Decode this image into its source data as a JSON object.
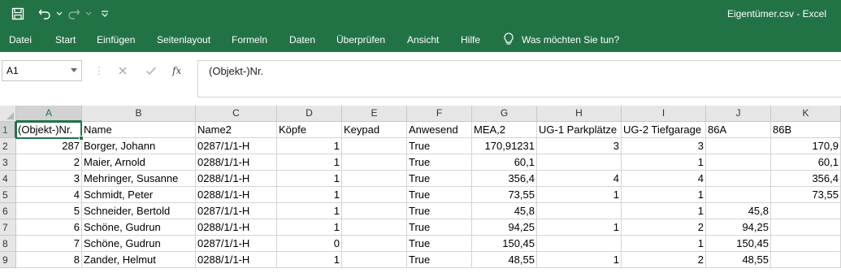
{
  "window": {
    "title": "Eigentümer.csv  -  Excel"
  },
  "qat": {
    "icons": [
      "save-icon",
      "undo-icon",
      "redo-icon",
      "customize-icon"
    ]
  },
  "ribbon": {
    "tabs": [
      "Datei",
      "Start",
      "Einfügen",
      "Seitenlayout",
      "Formeln",
      "Daten",
      "Überprüfen",
      "Ansicht",
      "Hilfe"
    ],
    "tell_me": "Was möchten Sie tun?"
  },
  "formula_bar": {
    "name_box": "A1",
    "fx_label": "fx",
    "value": "(Objekt-)Nr."
  },
  "colors": {
    "accent": "#217346",
    "header_bg": "#e6e6e6",
    "gridline": "#d4d4d4"
  },
  "sheet": {
    "columns": [
      "A",
      "B",
      "C",
      "D",
      "E",
      "F",
      "G",
      "H",
      "I",
      "J",
      "K"
    ],
    "row_numbers": [
      "1",
      "2",
      "3",
      "4",
      "5",
      "6",
      "7",
      "8",
      "9"
    ],
    "rows": [
      [
        "(Objekt-)Nr.",
        "Name",
        "Name2",
        "Köpfe",
        "Keypad",
        "Anwesend",
        "MEA,2",
        "UG-1 Parkplätze",
        "UG-2 Tiefgarage",
        "86A",
        "86B"
      ],
      [
        "287",
        "Borger, Johann",
        "0287/1/1-H",
        "1",
        "",
        "True",
        "170,91231",
        "3",
        "3",
        "",
        "170,9"
      ],
      [
        "2",
        "Maier, Arnold",
        "0288/1/1-H",
        "1",
        "",
        "True",
        "60,1",
        "",
        "1",
        "",
        "60,1"
      ],
      [
        "3",
        "Mehringer, Susanne",
        "0288/1/1-H",
        "1",
        "",
        "True",
        "356,4",
        "4",
        "4",
        "",
        "356,4"
      ],
      [
        "4",
        "Schmidt, Peter",
        "0288/1/1-H",
        "1",
        "",
        "True",
        "73,55",
        "1",
        "1",
        "",
        "73,55"
      ],
      [
        "5",
        "Schneider, Bertold",
        "0287/1/1-H",
        "1",
        "",
        "True",
        "45,8",
        "",
        "1",
        "45,8",
        ""
      ],
      [
        "6",
        "Schöne, Gudrun",
        "0288/1/1-H",
        "1",
        "",
        "True",
        "94,25",
        "1",
        "2",
        "94,25",
        ""
      ],
      [
        "7",
        "Schöne, Gudrun",
        "0287/1/1-H",
        "0",
        "",
        "True",
        "150,45",
        "",
        "1",
        "150,45",
        ""
      ],
      [
        "8",
        "Zander, Helmut",
        "0288/1/1-H",
        "1",
        "",
        "True",
        "48,55",
        "1",
        "2",
        "48,55",
        ""
      ]
    ]
  }
}
